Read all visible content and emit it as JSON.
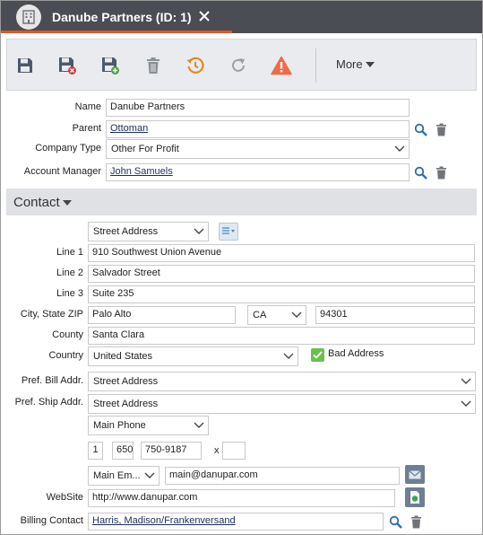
{
  "window": {
    "title": "Danube Partners (ID: 1)",
    "accent_color": "#e0562a",
    "icon": "building-icon",
    "close_icon": "close-icon"
  },
  "toolbar": {
    "buttons": [
      {
        "name": "save-button",
        "icon": "floppy-disk-icon"
      },
      {
        "name": "save-and-close-button",
        "icon": "floppy-disk-x-icon"
      },
      {
        "name": "save-and-new-button",
        "icon": "floppy-disk-plus-icon"
      },
      {
        "name": "delete-button",
        "icon": "trash-icon"
      },
      {
        "name": "history-button",
        "icon": "history-icon"
      },
      {
        "name": "refresh-button",
        "icon": "refresh-icon"
      },
      {
        "name": "alert-button",
        "icon": "warning-icon"
      }
    ],
    "more_label": "More"
  },
  "company": {
    "name_label": "Name",
    "name_value": "Danube Partners",
    "parent_label": "Parent",
    "parent_value": "Ottoman",
    "type_label": "Company Type",
    "type_value": "Other For Profit",
    "manager_label": "Account Manager",
    "manager_value": "John Samuels"
  },
  "contact": {
    "section_title": "Contact",
    "address_type": "Street Address",
    "line1_label": "Line 1",
    "line1_value": "910 Southwest Union Avenue",
    "line2_label": "Line 2",
    "line2_value": "Salvador Street",
    "line3_label": "Line 3",
    "line3_value": "Suite 235",
    "csz_label": "City, State ZIP",
    "city_value": "Palo Alto",
    "state_value": "CA",
    "zip_value": "94301",
    "county_label": "County",
    "county_value": "Santa Clara",
    "country_label": "Country",
    "country_value": "United States",
    "bad_address_label": "Bad Address",
    "bad_address_checked": true,
    "bill_label": "Pref. Bill Addr.",
    "bill_value": "Street Address",
    "ship_label": "Pref. Ship Addr.",
    "ship_value": "Street Address",
    "phone_type": "Main Phone",
    "phone_country": "1",
    "phone_area": "650",
    "phone_number": "750-9187",
    "phone_ext_label": "x",
    "phone_ext": "",
    "email_type": "Main Em...",
    "email_value": "main@danupar.com",
    "website_label": "WebSite",
    "website_value": "http://www.danupar.com",
    "billing_contact_label": "Billing Contact",
    "billing_contact_value": "Harris, Madison/Frankenversand"
  }
}
